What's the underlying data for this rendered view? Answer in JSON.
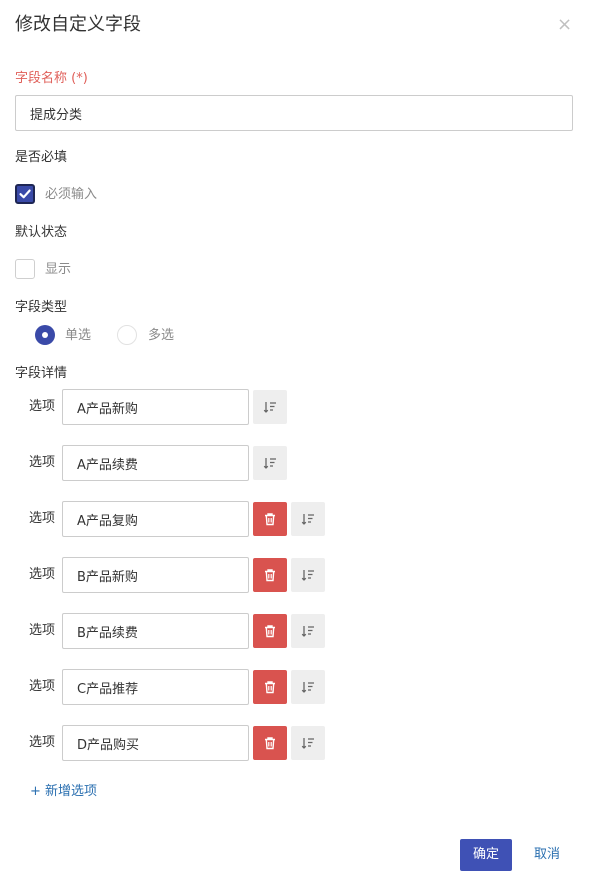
{
  "dialog": {
    "title": "修改自定义字段",
    "close_glyph": "×"
  },
  "field_name": {
    "label": "字段名称 (*)",
    "value": "提成分类"
  },
  "required": {
    "label": "是否必填",
    "checkbox_label": "必须输入",
    "checked": true
  },
  "default_state": {
    "label": "默认状态",
    "checkbox_label": "显示",
    "checked": false
  },
  "field_type": {
    "label": "字段类型",
    "options": [
      {
        "label": "单选",
        "selected": true
      },
      {
        "label": "多选",
        "selected": false
      }
    ]
  },
  "field_details": {
    "label": "字段详情",
    "option_prefix": "选项",
    "options": [
      {
        "value": "A产品新购",
        "deletable": false
      },
      {
        "value": "A产品续费",
        "deletable": false
      },
      {
        "value": "A产品复购",
        "deletable": true
      },
      {
        "value": "B产品新购",
        "deletable": true
      },
      {
        "value": "B产品续费",
        "deletable": true
      },
      {
        "value": "C产品推荐",
        "deletable": true
      },
      {
        "value": "D产品购买",
        "deletable": true
      }
    ],
    "add_option": "+ 新增选项"
  },
  "footer": {
    "confirm": "确定",
    "cancel": "取消"
  },
  "icons": {
    "check": "check-icon",
    "delete": "trash-icon",
    "sort": "sort-icon",
    "close": "close-icon"
  },
  "colors": {
    "primary": "#3f51b5",
    "danger": "#d9534f",
    "required_label": "#e0605a",
    "link": "#2a6fb0"
  }
}
